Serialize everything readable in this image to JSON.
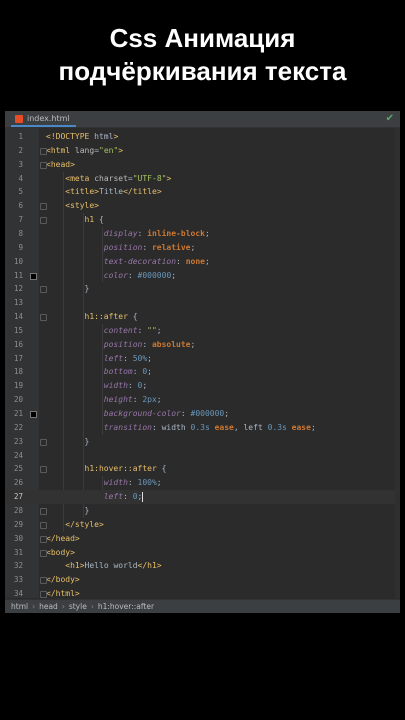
{
  "caption": {
    "line1": "Css Анимация",
    "line2": "подчёркивания текста"
  },
  "editor": {
    "tab_name": "index.html",
    "breadcrumbs": [
      "html",
      "head",
      "style",
      "h1:hover::after"
    ],
    "current_line": 27
  },
  "icons": {
    "file": "html-file-icon",
    "status": "check-icon"
  },
  "colors": {
    "tag": "#e8bf6a",
    "attribute": "#bababa",
    "string": "#a5c261",
    "property": "#9876aa",
    "keyword_value": "#cc7832",
    "number": "#6897bb",
    "plain": "#a9b7c6",
    "background": "#2b2b2b"
  },
  "code_lines": [
    "<!DOCTYPE html>",
    "<html lang=\"en\">",
    "<head>",
    "    <meta charset=\"UTF-8\">",
    "    <title>Title</title>",
    "    <style>",
    "        h1 {",
    "            display: inline-block;",
    "            position: relative;",
    "            text-decoration: none;",
    "            color: #000000;",
    "        }",
    "",
    "        h1::after {",
    "            content: \"\";",
    "            position: absolute;",
    "            left: 50%;",
    "            bottom: 0;",
    "            width: 0;",
    "            height: 2px;",
    "            background-color: #000000;",
    "            transition: width 0.3s ease, left 0.3s ease;",
    "        }",
    "",
    "        h1:hover::after {",
    "            width: 100%;",
    "            left: 0;",
    "        }",
    "    </style>",
    "</head>",
    "<body>",
    "    <h1>Hello world</h1>",
    "</body>",
    "</html>"
  ]
}
